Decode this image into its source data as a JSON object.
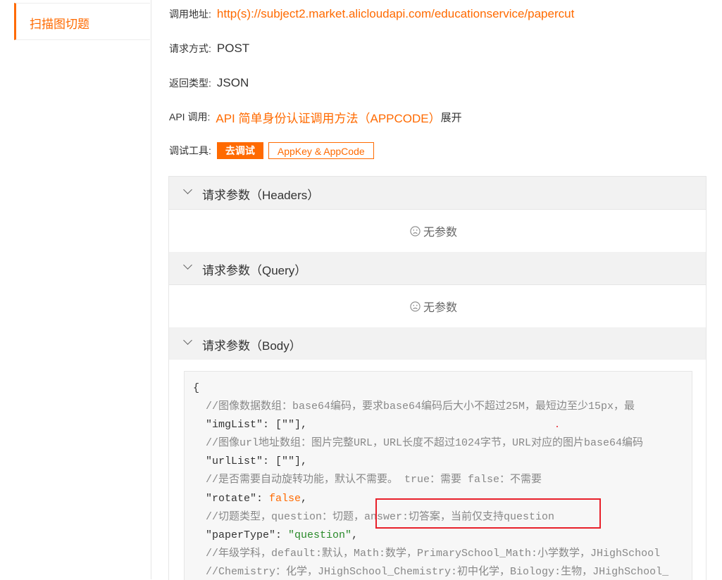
{
  "sidebar": {
    "active_item": "扫描图切题"
  },
  "info": {
    "url_label": "调用地址:",
    "url_value": "http(s)://subject2.market.alicloudapi.com/educationservice/papercut",
    "method_label": "请求方式:",
    "method_value": "POST",
    "return_label": "返回类型:",
    "return_value": "JSON",
    "api_label": "API 调用:",
    "api_link": "API 简单身份认证调用方法（APPCODE）",
    "api_expand": "展开",
    "tool_label": "调试工具:",
    "debug_button": "去调试",
    "appkey_button": "AppKey & AppCode"
  },
  "sections": {
    "headers": {
      "title": "请求参数（Headers）",
      "empty": "无参数"
    },
    "query": {
      "title": "请求参数（Query）",
      "empty": "无参数"
    },
    "body": {
      "title": "请求参数（Body）"
    }
  },
  "code": {
    "open_brace": "{",
    "c1": "  //图像数据数组：base64编码，要求base64编码后大小不超过25M，最短边至少15px，最",
    "k1": "  \"imgList\"",
    "v1": ": [\"\"],",
    "c2": "  //图像url地址数组：图片完整URL，URL长度不超过1024字节，URL对应的图片base64编码",
    "k2": "  \"urlList\"",
    "v2": ": [\"\"],",
    "c3": "  //是否需要自动旋转功能，默认不需要。 true：需要 false：不需要",
    "k3": "  \"rotate\"",
    "s3": ": ",
    "v3": "false",
    "e3": ",",
    "c4": "  //切题类型，question：切题，answer:切答案，当前仅支持question",
    "k4": "  \"paperType\"",
    "s4": ": ",
    "v4": "\"question\"",
    "e4": ",",
    "c5": "  //年级学科，default:默认，Math:数学，PrimarySchool_Math:小学数学，JHighSchool",
    "c6": "  //Chemistry：化学，JHighSchool_Chemistry:初中化学，Biology:生物，JHighSchool_"
  },
  "colors": {
    "accent": "#ff6a00",
    "highlight": "#e8202a"
  },
  "icons": {
    "section_toggle": "chevron-down-icon",
    "empty_state": "sad-face-icon"
  }
}
